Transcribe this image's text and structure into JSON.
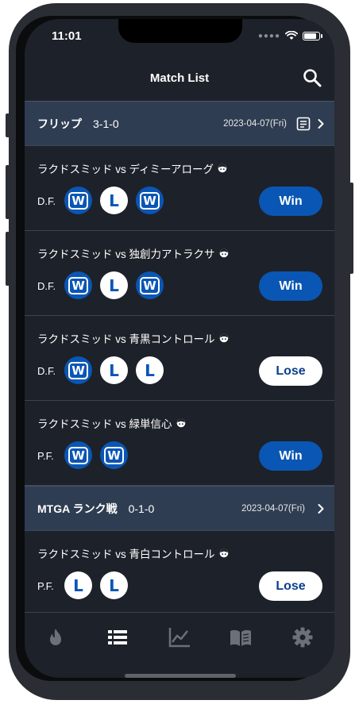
{
  "status": {
    "time": "11:01"
  },
  "navbar": {
    "title": "Match List"
  },
  "groups": [
    {
      "name": "フリップ",
      "record": "3-1-0",
      "date": "2023-04-07(Fri)",
      "has_note": true,
      "matches": [
        {
          "title": "ラクドスミッド vs ディミーアローグ",
          "mode": "D.F.",
          "games": [
            "W",
            "L",
            "W"
          ],
          "result": "Win"
        },
        {
          "title": "ラクドスミッド vs 独創力アトラクサ",
          "mode": "D.F.",
          "games": [
            "W",
            "L",
            "W"
          ],
          "result": "Win"
        },
        {
          "title": "ラクドスミッド vs 青黒コントロール",
          "mode": "D.F.",
          "games": [
            "W",
            "L",
            "L"
          ],
          "result": "Lose"
        },
        {
          "title": "ラクドスミッド vs 緑単信心",
          "mode": "P.F.",
          "games": [
            "W",
            "W"
          ],
          "result": "Win"
        }
      ]
    },
    {
      "name": "MTGA ランク戦",
      "record": "0-1-0",
      "date": "2023-04-07(Fri)",
      "has_note": false,
      "matches": [
        {
          "title": "ラクドスミッド vs 青白コントロール",
          "mode": "P.F.",
          "games": [
            "L",
            "L"
          ],
          "result": "Lose"
        }
      ]
    }
  ],
  "tabs": [
    "flame-icon",
    "list-icon",
    "chart-icon",
    "book-icon",
    "gear-icon"
  ],
  "colors": {
    "accent": "#0a56b4",
    "background": "#1d2129",
    "header": "#2f3d52"
  }
}
